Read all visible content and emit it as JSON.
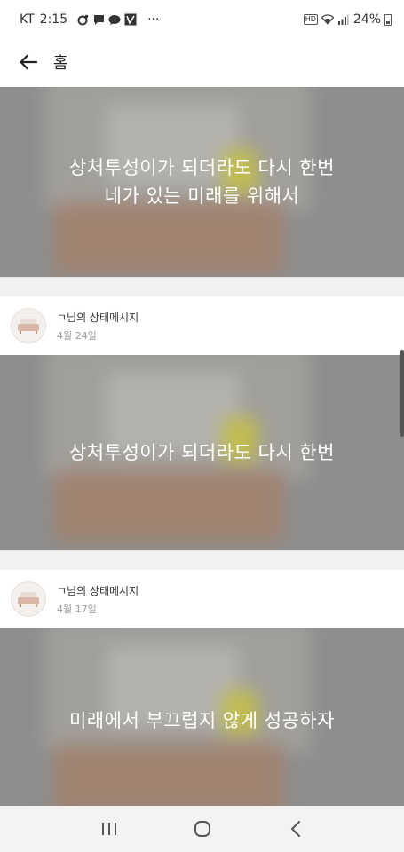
{
  "status_bar": {
    "carrier": "KT",
    "time": "2:15",
    "more": "···",
    "network": "HD",
    "battery": "24%"
  },
  "app_bar": {
    "title": "홈"
  },
  "posts": [
    {
      "text": "상처투성이가 되더라도 다시 한번\n네가 있는 미래를 위해서"
    },
    {
      "title": "ㄱ님의 상태메시지",
      "date": "4월 24일",
      "text": "상처투성이가 되더라도 다시 한번"
    },
    {
      "title": "ㄱ님의 상태메시지",
      "date": "4월 17일",
      "text": "미래에서 부끄럽지 않게 성공하자"
    }
  ],
  "icons": {
    "back": "arrow-left-icon",
    "recents": "recents-icon",
    "home": "home-icon",
    "nav_back": "chevron-left-icon"
  },
  "colors": {
    "image_overlay": "#9a9a9a",
    "yellow_highlight": "#e8e23a"
  }
}
